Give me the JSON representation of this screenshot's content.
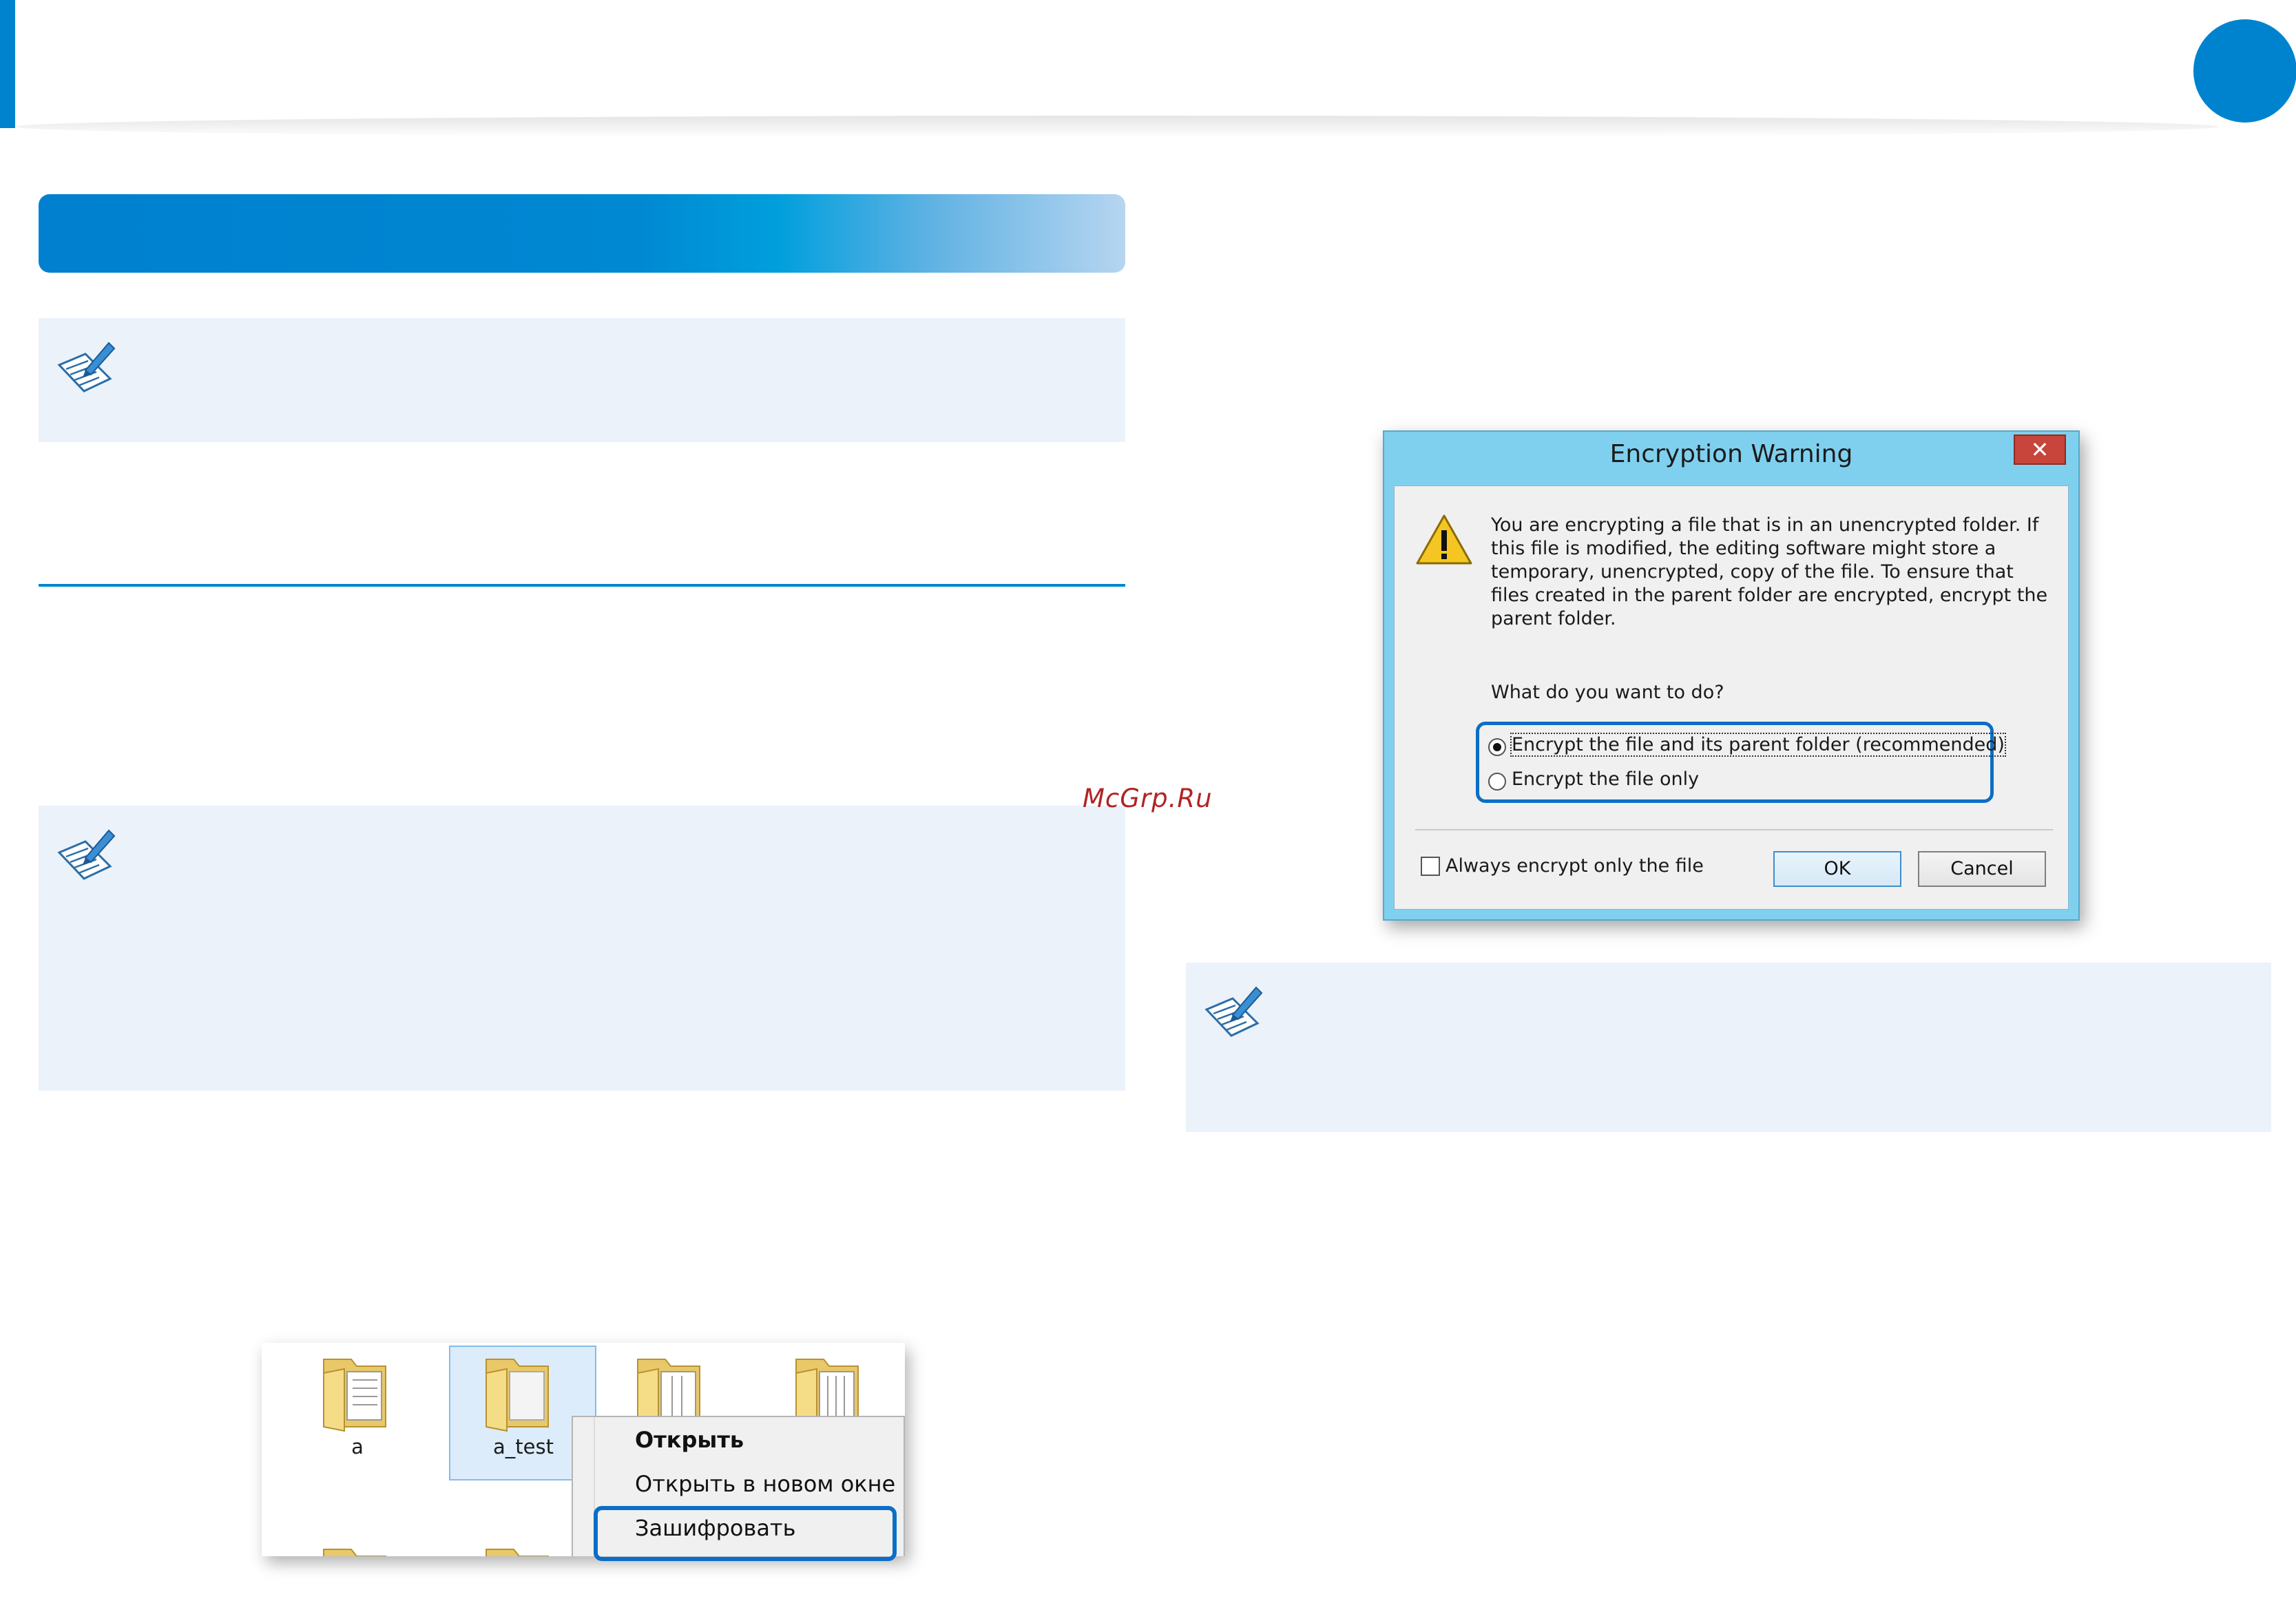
{
  "page": {
    "accent_color": "#0083cf",
    "note_bg_color": "#ebf2fa",
    "watermark": "McGrp.Ru",
    "note_icon": "pen-and-paper-note-icon"
  },
  "dialog": {
    "title": "Encryption Warning",
    "close_glyph": "x",
    "message": "You are encrypting a file that is in an unencrypted folder. If this file is modified, the editing software might store a temporary, unencrypted, copy of the file. To ensure that files created in the parent folder are encrypted, encrypt the parent folder.",
    "question": "What do you want to do?",
    "options": [
      {
        "label": "Encrypt the file and its parent folder (recommended)",
        "selected": true
      },
      {
        "label": "Encrypt the file only",
        "selected": false
      }
    ],
    "always_label": "Always encrypt only the file",
    "always_checked": false,
    "ok_label": "OK",
    "cancel_label": "Cancel",
    "warning_icon": "warning-triangle-icon"
  },
  "explorer": {
    "folders": [
      {
        "label": "a"
      },
      {
        "label": "a_test",
        "selected": true
      },
      {
        "label": ""
      },
      {
        "label": ""
      }
    ],
    "context_menu": [
      {
        "label": "Открыть",
        "bold": true
      },
      {
        "label": "Открыть в новом окне",
        "bold": false
      },
      {
        "label": "Зашифровать",
        "bold": false,
        "highlighted": true
      }
    ]
  }
}
